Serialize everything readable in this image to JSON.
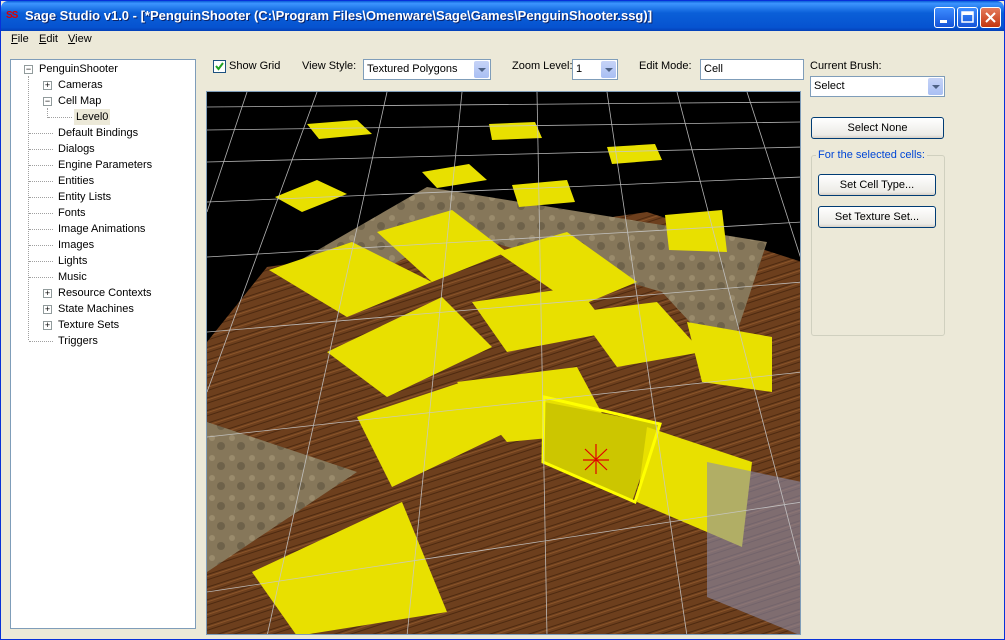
{
  "window": {
    "title": "Sage Studio v1.0 - [*PenguinShooter (C:\\Program Files\\Omenware\\Sage\\Games\\PenguinShooter.ssg)]",
    "icon_text": "SS"
  },
  "menu": [
    {
      "label": "File",
      "accel": "F",
      "rest": "ile"
    },
    {
      "label": "Edit",
      "accel": "E",
      "rest": "dit"
    },
    {
      "label": "View",
      "accel": "V",
      "rest": "iew"
    }
  ],
  "tree": {
    "root": "PenguinShooter",
    "items": [
      {
        "label": "Cameras",
        "expandable": true,
        "expanded": false
      },
      {
        "label": "Cell Map",
        "expandable": true,
        "expanded": true
      },
      {
        "label": "Level0",
        "child": true,
        "selected": true
      },
      {
        "label": "Default Bindings"
      },
      {
        "label": "Dialogs"
      },
      {
        "label": "Engine Parameters"
      },
      {
        "label": "Entities"
      },
      {
        "label": "Entity Lists"
      },
      {
        "label": "Fonts"
      },
      {
        "label": "Image Animations"
      },
      {
        "label": "Images"
      },
      {
        "label": "Lights"
      },
      {
        "label": "Music"
      },
      {
        "label": "Resource Contexts",
        "expandable": true,
        "expanded": false
      },
      {
        "label": "State Machines",
        "expandable": true,
        "expanded": false
      },
      {
        "label": "Texture Sets",
        "expandable": true,
        "expanded": false
      },
      {
        "label": "Triggers"
      }
    ]
  },
  "toolbar": {
    "show_grid": {
      "label": "Show Grid",
      "checked": true
    },
    "view_style": {
      "label": "View Style:",
      "value": "Textured Polygons"
    },
    "zoom_level": {
      "label": "Zoom Level:",
      "value": "1"
    },
    "edit_mode": {
      "label": "Edit Mode:",
      "value": "Cell"
    }
  },
  "right_panel": {
    "current_brush_label": "Current Brush:",
    "current_brush_value": "Select",
    "select_none": "Select None",
    "group_title": "For the selected cells:",
    "set_cell_type": "Set Cell Type...",
    "set_texture_set": "Set Texture Set..."
  },
  "colors": {
    "selection_yellow": "#e8e000",
    "selection_outline": "#ffff00",
    "floor_wood": "#6b3d1c",
    "wall_stone": "#8a7a5a",
    "grid_line": "#c8c8c8"
  }
}
